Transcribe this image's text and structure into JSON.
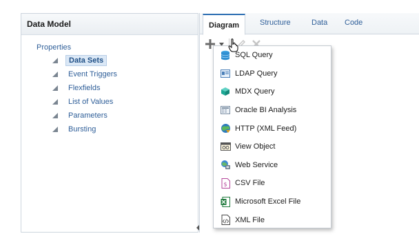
{
  "left_panel": {
    "title": "Data Model",
    "root": "Properties",
    "items": [
      {
        "label": "Data Sets",
        "selected": true
      },
      {
        "label": "Event Triggers",
        "selected": false
      },
      {
        "label": "Flexfields",
        "selected": false
      },
      {
        "label": "List of Values",
        "selected": false
      },
      {
        "label": "Parameters",
        "selected": false
      },
      {
        "label": "Bursting",
        "selected": false
      }
    ]
  },
  "tabs": [
    {
      "label": "Diagram",
      "active": true
    },
    {
      "label": "Structure",
      "active": false
    },
    {
      "label": "Data",
      "active": false
    },
    {
      "label": "Code",
      "active": false
    }
  ],
  "menu": {
    "items": [
      {
        "label": "SQL Query",
        "icon": "database-icon"
      },
      {
        "label": "LDAP Query",
        "icon": "ldap-icon"
      },
      {
        "label": "MDX Query",
        "icon": "cube-icon"
      },
      {
        "label": "Oracle BI Analysis",
        "icon": "analysis-icon"
      },
      {
        "label": "HTTP (XML Feed)",
        "icon": "feed-icon"
      },
      {
        "label": "View Object",
        "icon": "view-object-icon"
      },
      {
        "label": "Web Service",
        "icon": "web-service-icon"
      },
      {
        "label": "CSV File",
        "icon": "csv-file-icon"
      },
      {
        "label": "Microsoft Excel File",
        "icon": "excel-file-icon"
      },
      {
        "label": "XML File",
        "icon": "xml-file-icon"
      }
    ]
  },
  "colors": {
    "link": "#2e5e98",
    "accent": "#2e6fb3",
    "selected_bg": "#dbe8f6"
  }
}
